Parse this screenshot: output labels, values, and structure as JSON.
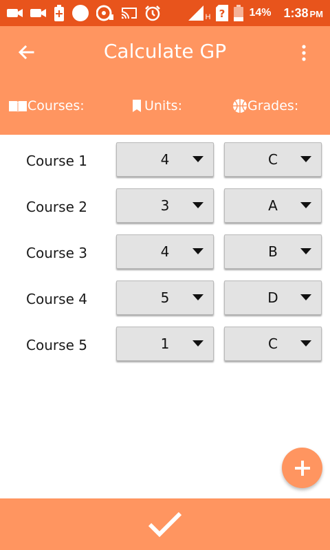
{
  "status_bar": {
    "battery_percent": "14%",
    "time": "1:38",
    "ampm": "PM",
    "network_label": "H",
    "icons": [
      "camera-icon",
      "camera-icon",
      "battery-charging-icon",
      "circle-icon",
      "cd-icon",
      "cast-icon",
      "alarm-icon",
      "signal-icon",
      "sim-icon",
      "battery-low-icon"
    ]
  },
  "app_bar": {
    "title": "Calculate GP",
    "back_icon": "arrow-back-icon",
    "menu_icon": "more-vert-icon"
  },
  "headers": {
    "courses": "Courses:",
    "units": "Units:",
    "grades": "Grades:"
  },
  "courses": [
    {
      "label": "Course 1",
      "units": "4",
      "grade": "C"
    },
    {
      "label": "Course 2",
      "units": "3",
      "grade": "A"
    },
    {
      "label": "Course 3",
      "units": "4",
      "grade": "B"
    },
    {
      "label": "Course 4",
      "units": "5",
      "grade": "D"
    },
    {
      "label": "Course 5",
      "units": "1",
      "grade": "C"
    }
  ],
  "colors": {
    "status_bar": "#e8541c",
    "primary": "#ff9560",
    "spinner_bg": "#e3e3e3"
  },
  "fab": {
    "icon": "add-icon"
  },
  "bottom": {
    "icon": "check-icon"
  }
}
